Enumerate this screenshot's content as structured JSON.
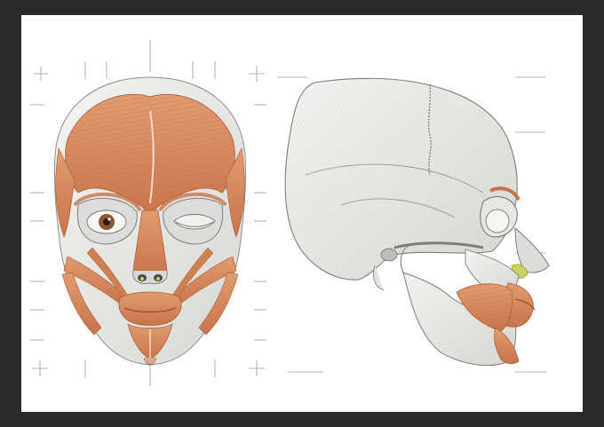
{
  "artwork": {
    "subject": "anatomical-facial-muscle-study",
    "panels": [
      "front-view-face-muscles",
      "side-view-skull"
    ],
    "colors": {
      "frame": "#2b2b2b",
      "paper": "#ffffff",
      "muscle": "#d98b5f",
      "muscle_dark": "#b8643c",
      "bone": "#ececea",
      "bone_shadow": "#c9c9c6",
      "ink": "#6b6b6b",
      "guide": "#9a9a9a",
      "iris": "#8a5a2b",
      "nasal_highlight": "#c9d25a"
    }
  }
}
